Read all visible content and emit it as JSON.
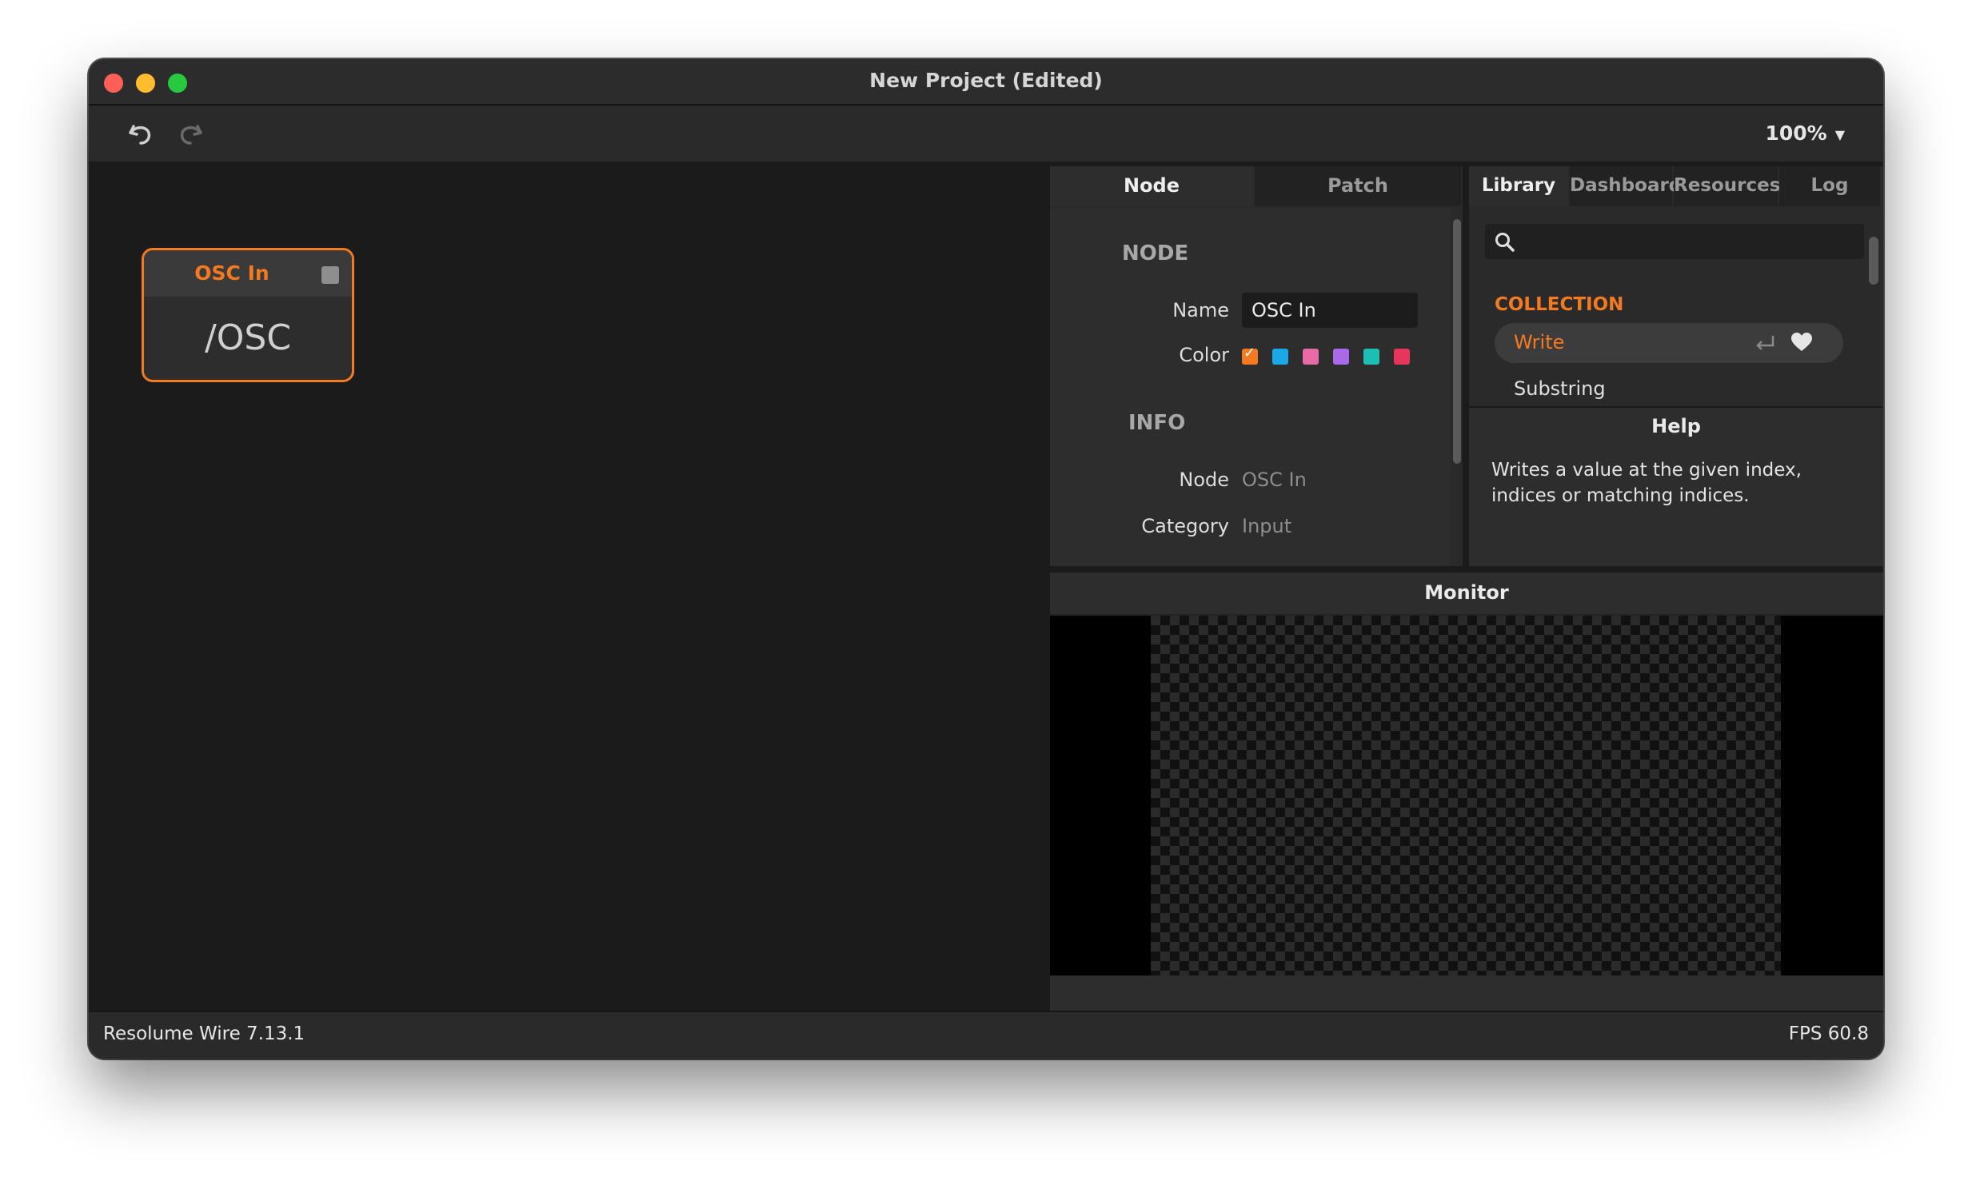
{
  "window": {
    "title": "New Project (Edited)"
  },
  "toolbar": {
    "zoom": "100%"
  },
  "canvas": {
    "node": {
      "title": "OSC In",
      "body": "/OSC",
      "accent": "#f47a22"
    }
  },
  "inspector": {
    "tabs": [
      {
        "label": "Node"
      },
      {
        "label": "Patch"
      }
    ],
    "node_section": "NODE",
    "name_label": "Name",
    "name_value": "OSC In",
    "color_label": "Color",
    "colors": [
      "#f47a22",
      "#1aa9e6",
      "#e86aa6",
      "#a86ae8",
      "#1dbfb2",
      "#e8355b"
    ],
    "selected_color": "#f47a22",
    "info_section": "INFO",
    "info": [
      {
        "label": "Node",
        "value": "OSC In"
      },
      {
        "label": "Category",
        "value": "Input"
      }
    ]
  },
  "library": {
    "tabs": [
      {
        "label": "Library"
      },
      {
        "label": "Dashboard"
      },
      {
        "label": "Resources"
      },
      {
        "label": "Log"
      }
    ],
    "search": {
      "placeholder": ""
    },
    "collection_heading": "COLLECTION",
    "items": [
      {
        "label": "Write"
      },
      {
        "label": "Substring"
      }
    ],
    "help_title": "Help",
    "help_text": "Writes a value at the given index, indices or matching indices."
  },
  "monitor": {
    "title": "Monitor"
  },
  "status": {
    "app_version": "Resolume Wire 7.13.1",
    "fps": "FPS 60.8"
  }
}
